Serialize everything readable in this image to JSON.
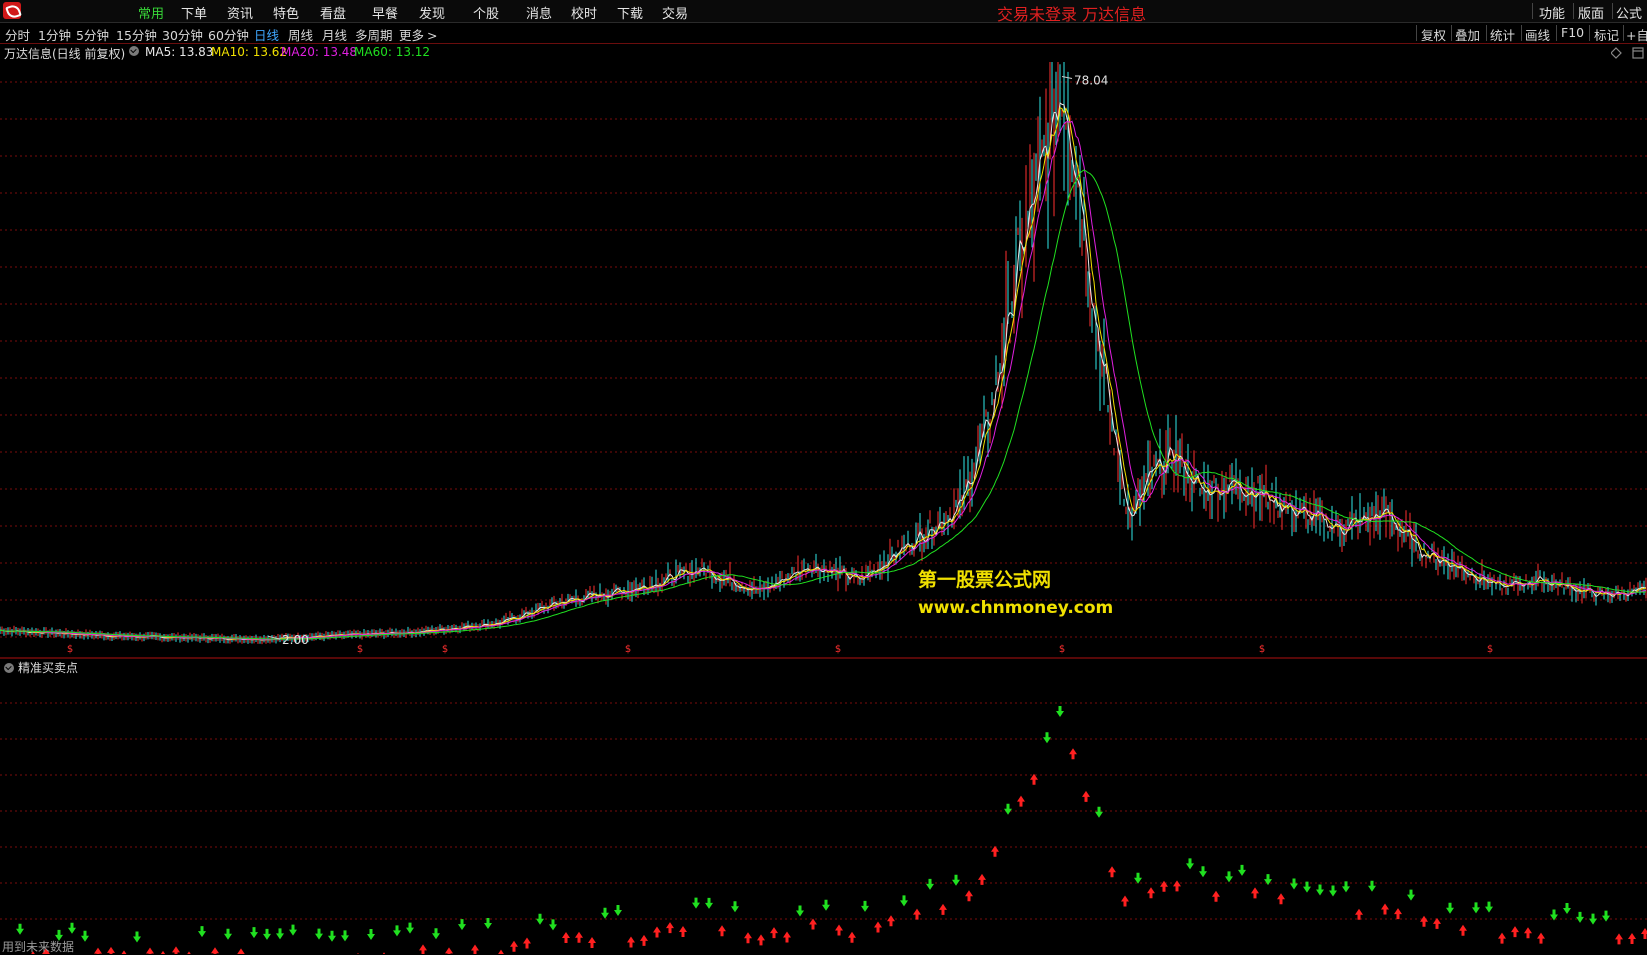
{
  "menu": {
    "items": [
      {
        "label": "常用",
        "active": true
      },
      {
        "label": "下单",
        "active": false
      },
      {
        "label": "资讯",
        "active": false
      },
      {
        "label": "特色",
        "active": false
      },
      {
        "label": "看盘",
        "active": false
      },
      {
        "label": "早餐",
        "active": false
      },
      {
        "label": "发现",
        "active": false
      },
      {
        "label": "个股",
        "active": false
      },
      {
        "label": "消息",
        "active": false
      },
      {
        "label": "校时",
        "active": false
      },
      {
        "label": "下载",
        "active": false
      },
      {
        "label": "交易",
        "active": false
      }
    ],
    "status_text": "交易未登录    万达信息",
    "right_items": [
      "功能",
      "版面",
      "公式"
    ]
  },
  "periods": {
    "items": [
      "分时",
      "1分钟",
      "5分钟",
      "15分钟",
      "30分钟",
      "60分钟",
      "日线",
      "周线",
      "月线",
      "多周期",
      "更多"
    ],
    "active": "日线",
    "more_chevron": ">"
  },
  "toolbar": {
    "items": [
      "复权",
      "叠加",
      "统计",
      "画线",
      "F10",
      "标记",
      "+自"
    ]
  },
  "info": {
    "stock_title": "万达信息(日线 前复权)",
    "ma5": "MA5: 13.83",
    "ma10": "MA10: 13.62",
    "ma20": "MA20: 13.48",
    "ma60": "MA60: 13.12",
    "colors": {
      "ma5": "#e8e8e8",
      "ma10": "#f0e000",
      "ma20": "#e020e0",
      "ma60": "#20e020"
    }
  },
  "chart_data": {
    "type": "line",
    "title": "万达信息(日线 前复权)",
    "annotations": [
      {
        "label": "78.04",
        "kind": "high"
      },
      {
        "label": "2.00",
        "kind": "low"
      }
    ],
    "dividend_marker": "$",
    "series": [
      {
        "name": "MA5",
        "value": 13.83,
        "color": "#e8e8e8"
      },
      {
        "name": "MA10",
        "value": 13.62,
        "color": "#f0e000"
      },
      {
        "name": "MA20",
        "value": 13.48,
        "color": "#e020e0"
      },
      {
        "name": "MA60",
        "value": 13.12,
        "color": "#20e020"
      }
    ],
    "ylim": [
      0,
      80
    ],
    "grid": true
  },
  "indicator": {
    "title": "精准买卖点",
    "buy_color": "#ff2020",
    "sell_color": "#20e020"
  },
  "watermark": {
    "cn": "第一股票公式网",
    "url": "www.chnmoney.com"
  },
  "footer": {
    "text": "用到未来数据"
  }
}
